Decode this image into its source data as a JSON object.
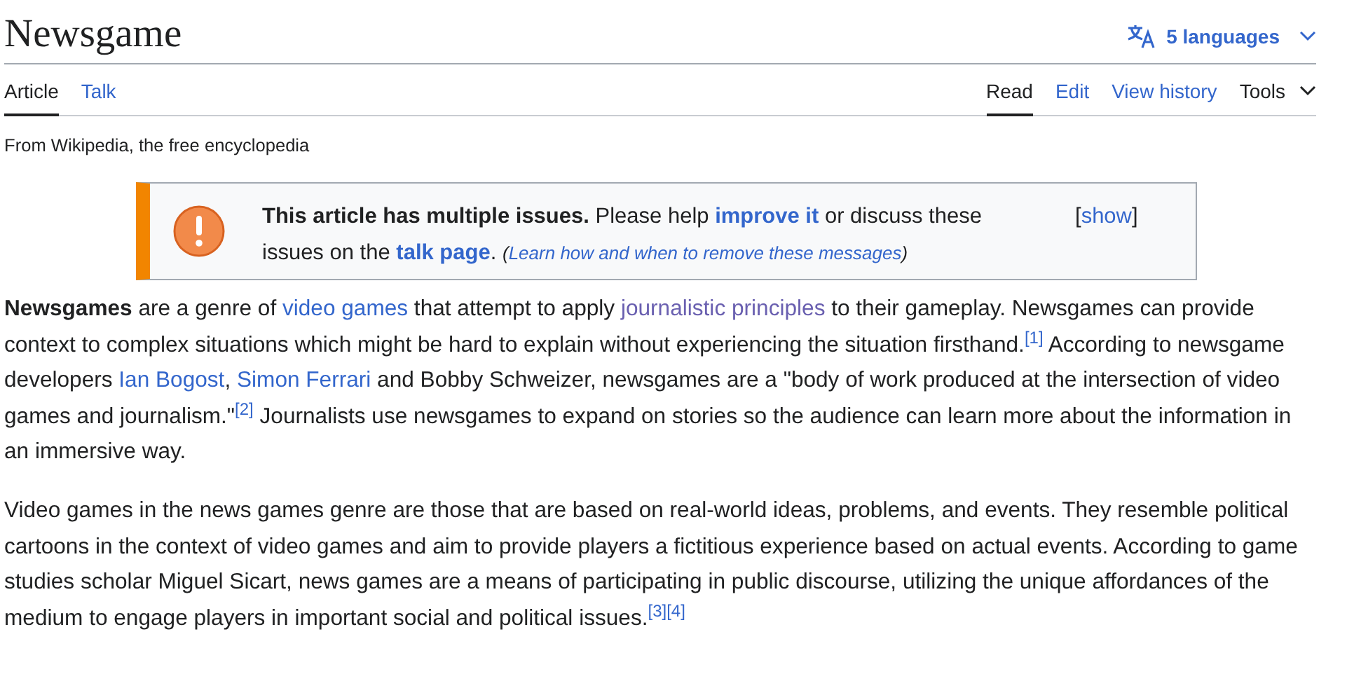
{
  "title": "Newsgame",
  "languages": {
    "label": "5 languages"
  },
  "tabs_left": [
    {
      "label": "Article",
      "selected": true
    },
    {
      "label": "Talk",
      "selected": false
    }
  ],
  "tabs_right": [
    {
      "label": "Read",
      "selected": true,
      "kind": "tab"
    },
    {
      "label": "Edit",
      "selected": false,
      "kind": "tab"
    },
    {
      "label": "View history",
      "selected": false,
      "kind": "tab"
    },
    {
      "label": "Tools",
      "selected": false,
      "kind": "menu"
    }
  ],
  "tagline": "From Wikipedia, the free encyclopedia",
  "notice": {
    "segments": [
      {
        "kind": "text",
        "text": "**This article has multiple issues.** Please help "
      },
      {
        "kind": "link",
        "text": "improve it",
        "bold": true
      },
      {
        "kind": "text",
        "text": " or discuss these issues on the "
      },
      {
        "kind": "link",
        "text": "talk page",
        "bold": true
      },
      {
        "kind": "text",
        "text": ". "
      },
      {
        "kind": "small",
        "text": "("
      },
      {
        "kind": "smalllink",
        "text": "Learn how and when to remove these messages"
      },
      {
        "kind": "small",
        "text": ")"
      }
    ],
    "toggle_open": "[",
    "toggle": "show",
    "toggle_close": "]"
  },
  "paragraphs": [
    [
      {
        "kind": "text",
        "text": "**Newsgames** are a genre of "
      },
      {
        "kind": "link",
        "text": "video games"
      },
      {
        "kind": "text",
        "text": " that attempt to apply "
      },
      {
        "kind": "link",
        "text": "journalistic principles",
        "visited": true
      },
      {
        "kind": "text",
        "text": " to their gameplay. Newsgames can provide context to complex situations which might be hard to explain without experiencing the situation firsthand."
      },
      {
        "kind": "ref",
        "text": "[1]"
      },
      {
        "kind": "text",
        "text": " According to newsgame developers "
      },
      {
        "kind": "link",
        "text": "Ian Bogost"
      },
      {
        "kind": "text",
        "text": ", "
      },
      {
        "kind": "link",
        "text": "Simon Ferrari"
      },
      {
        "kind": "text",
        "text": " and Bobby Schweizer, newsgames are a \"body of work produced at the intersection of video games and journalism.\""
      },
      {
        "kind": "ref",
        "text": "[2]"
      },
      {
        "kind": "text",
        "text": " Journalists use newsgames to expand on stories so the audience can learn more about the information in an immersive way."
      }
    ],
    [
      {
        "kind": "text",
        "text": "Video games in the news games genre are those that are based on real-world ideas, problems, and events. They resemble political cartoons in the context of video games and aim to provide players a fictitious experience based on actual events. According to game studies scholar Miguel Sicart, news games are a means of participating in public discourse, utilizing the unique affordances of the medium to engage players in important social and political issues."
      },
      {
        "kind": "ref",
        "text": "[3]"
      },
      {
        "kind": "ref",
        "text": "[4]"
      }
    ]
  ]
}
